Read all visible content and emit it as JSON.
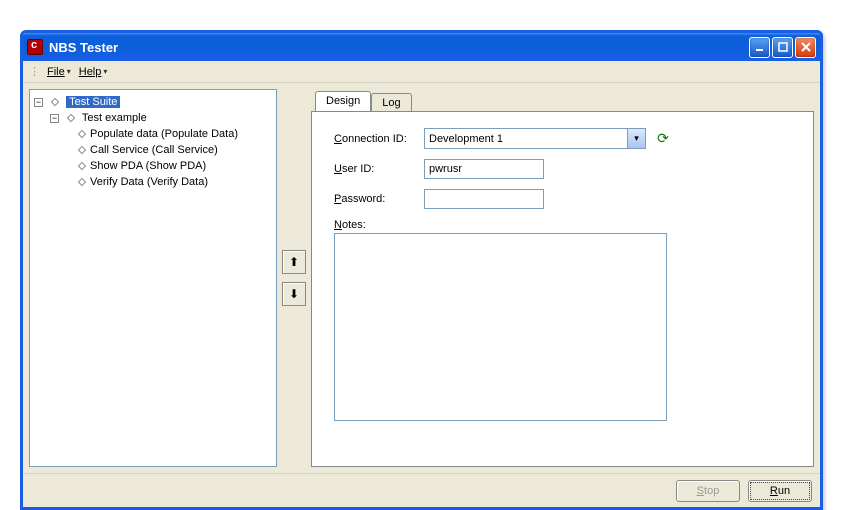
{
  "title": "NBS Tester",
  "menu": {
    "file": "File",
    "help": "Help"
  },
  "tree": {
    "root": "Test Suite",
    "child": "Test example",
    "leaves": [
      "Populate data (Populate Data)",
      "Call Service (Call Service)",
      "Show PDA (Show PDA)",
      "Verify Data (Verify Data)"
    ]
  },
  "tabs": {
    "design": "Design",
    "log": "Log"
  },
  "form": {
    "connection_label": "Connection ID:",
    "connection_value": "Development 1",
    "userid_label": "User ID:",
    "userid_value": "pwrusr",
    "password_label": "Password:",
    "password_value": "",
    "notes_label": "Notes:",
    "notes_value": ""
  },
  "footer": {
    "stop": "Stop",
    "run": "Run"
  }
}
